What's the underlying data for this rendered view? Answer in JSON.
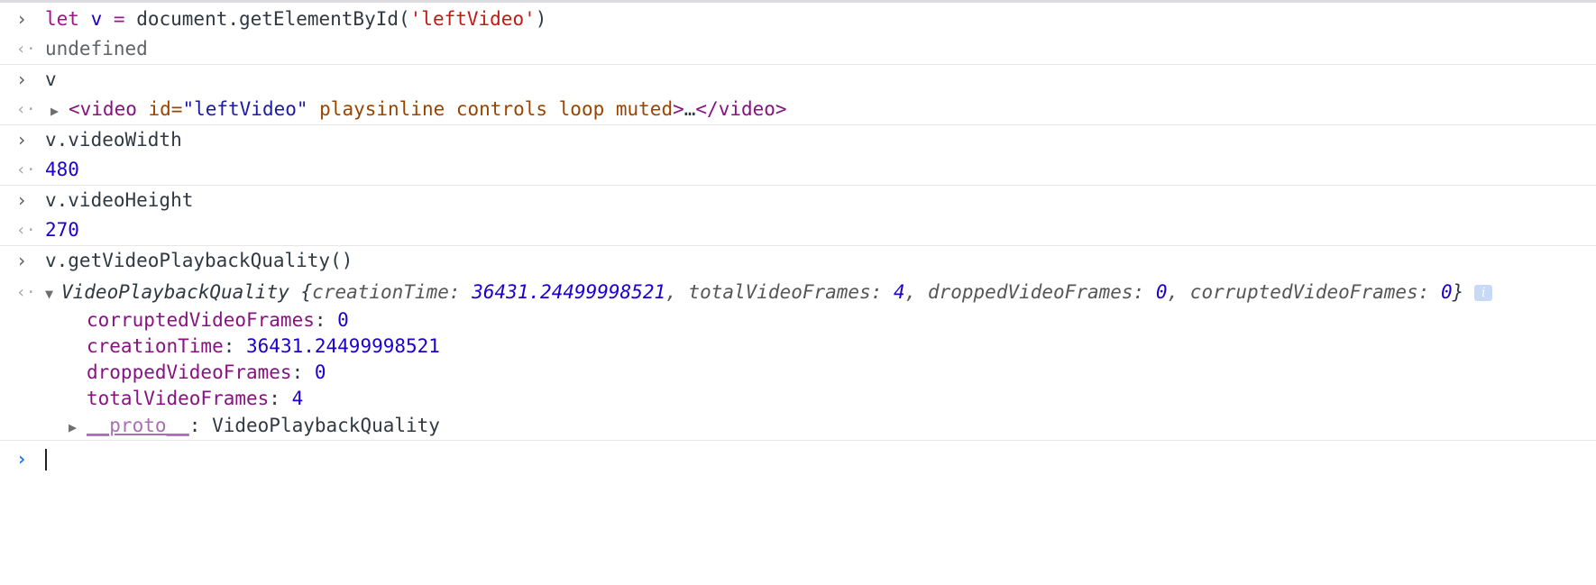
{
  "console": {
    "entries": [
      {
        "input": {
          "tokens": {
            "kw_let": "let",
            "var_v": "v",
            "op_eq": "=",
            "call_prefix": "document.getElementById(",
            "arg": "'leftVideo'",
            "call_suffix": ")"
          }
        },
        "output": {
          "value": "undefined"
        }
      },
      {
        "input": {
          "text": "v"
        },
        "output": {
          "open_tag_start": "<video",
          "attr_id_name": " id=",
          "attr_id_value": "\"leftVideo\"",
          "attr_rest": " playsinline controls loop muted",
          "open_tag_end": ">",
          "ellipsis": "…",
          "close_tag": "</video>"
        }
      },
      {
        "input": {
          "text": "v.videoWidth"
        },
        "output": {
          "value": "480"
        }
      },
      {
        "input": {
          "text": "v.videoHeight"
        },
        "output": {
          "value": "270"
        }
      },
      {
        "input": {
          "text": "v.getVideoPlaybackQuality()"
        },
        "output": {
          "class_name": "VideoPlaybackQuality",
          "summary": {
            "open_brace": " {",
            "creationTime_key": "creationTime",
            "creationTime_val": "36431.24499998521",
            "totalVideoFrames_key": "totalVideoFrames",
            "totalVideoFrames_val": "4",
            "droppedVideoFrames_key": "droppedVideoFrames",
            "droppedVideoFrames_val": "0",
            "corruptedVideoFrames_key": "corruptedVideoFrames",
            "corruptedVideoFrames_val": "0",
            "close_brace": "}"
          },
          "info_badge": "i",
          "properties": [
            {
              "key": "corruptedVideoFrames",
              "value": "0"
            },
            {
              "key": "creationTime",
              "value": "36431.24499998521"
            },
            {
              "key": "droppedVideoFrames",
              "value": "0"
            },
            {
              "key": "totalVideoFrames",
              "value": "4"
            }
          ],
          "proto": {
            "key": "__proto__",
            "value": "VideoPlaybackQuality"
          }
        }
      }
    ],
    "glyphs": {
      "prompt": "›",
      "result": "‹·",
      "expand_right": "▶",
      "expand_down": "▼"
    },
    "input_line": {
      "value": ""
    }
  }
}
